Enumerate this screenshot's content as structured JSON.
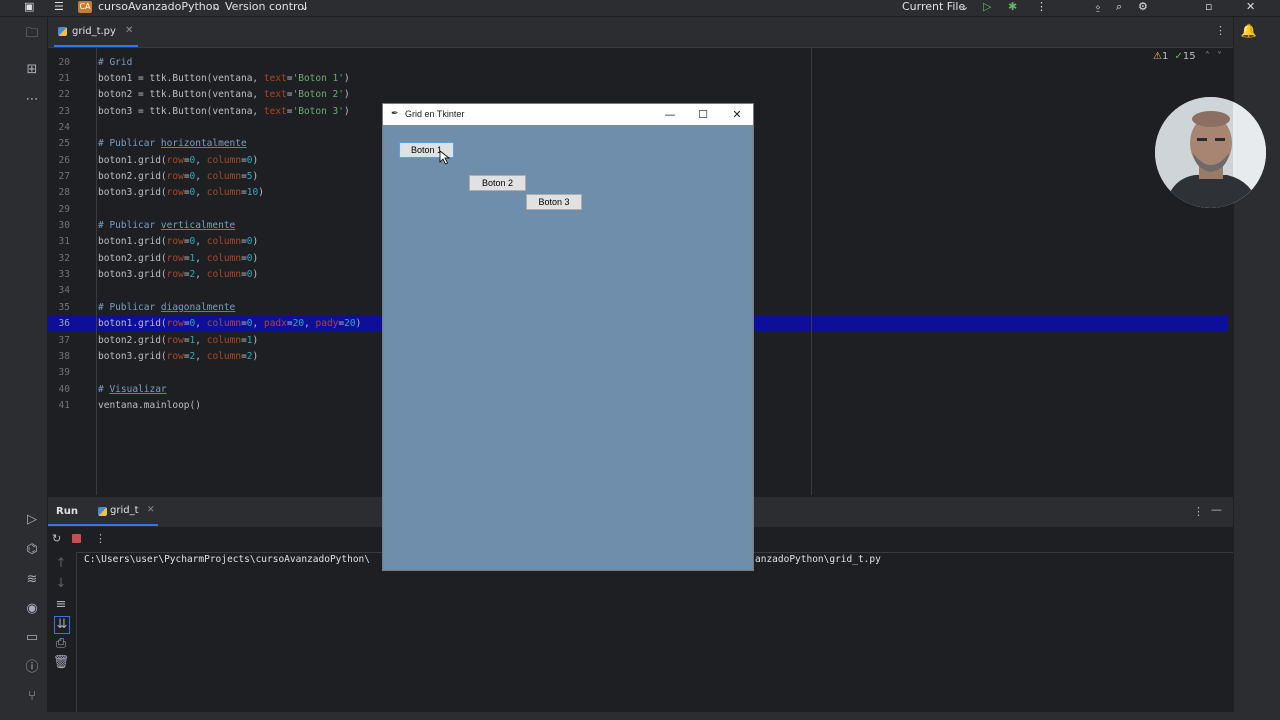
{
  "topbar": {
    "project_badge": "CA",
    "project_name": "cursoAvanzadoPython",
    "vcs": "Version control",
    "run_config": "Current File"
  },
  "editor": {
    "tab_file": "grid_t.py",
    "inspections": {
      "warnings": "1",
      "ok": "15"
    },
    "line_numbers": [
      "20",
      "21",
      "22",
      "23",
      "24",
      "25",
      "26",
      "27",
      "28",
      "29",
      "30",
      "31",
      "32",
      "33",
      "34",
      "35",
      "36",
      "37",
      "38",
      "39",
      "40",
      "41"
    ],
    "current_line": "36"
  },
  "tk_window": {
    "title": "Grid en Tkinter",
    "buttons": {
      "b1": "Boton 1",
      "b2": "Boton 2",
      "b3": "Boton 3"
    }
  },
  "run_panel": {
    "title": "Run",
    "tab": "grid_t",
    "console_left": "C:\\Users\\user\\PycharmProjects\\cursoAvanzadoPython\\",
    "console_right": "anzadoPython\\grid_t.py"
  },
  "icons": {
    "folder": "folder-icon",
    "structure": "structure-icon",
    "more": "more-icon",
    "run": "run-icon",
    "debug": "debug-icon",
    "settings": "gear-icon",
    "search": "search-icon",
    "notifications": "bell-icon"
  },
  "colors": {
    "accent": "#3574f0",
    "highlight_line": "#0d0f9a",
    "tk_background": "#6e8eac"
  }
}
